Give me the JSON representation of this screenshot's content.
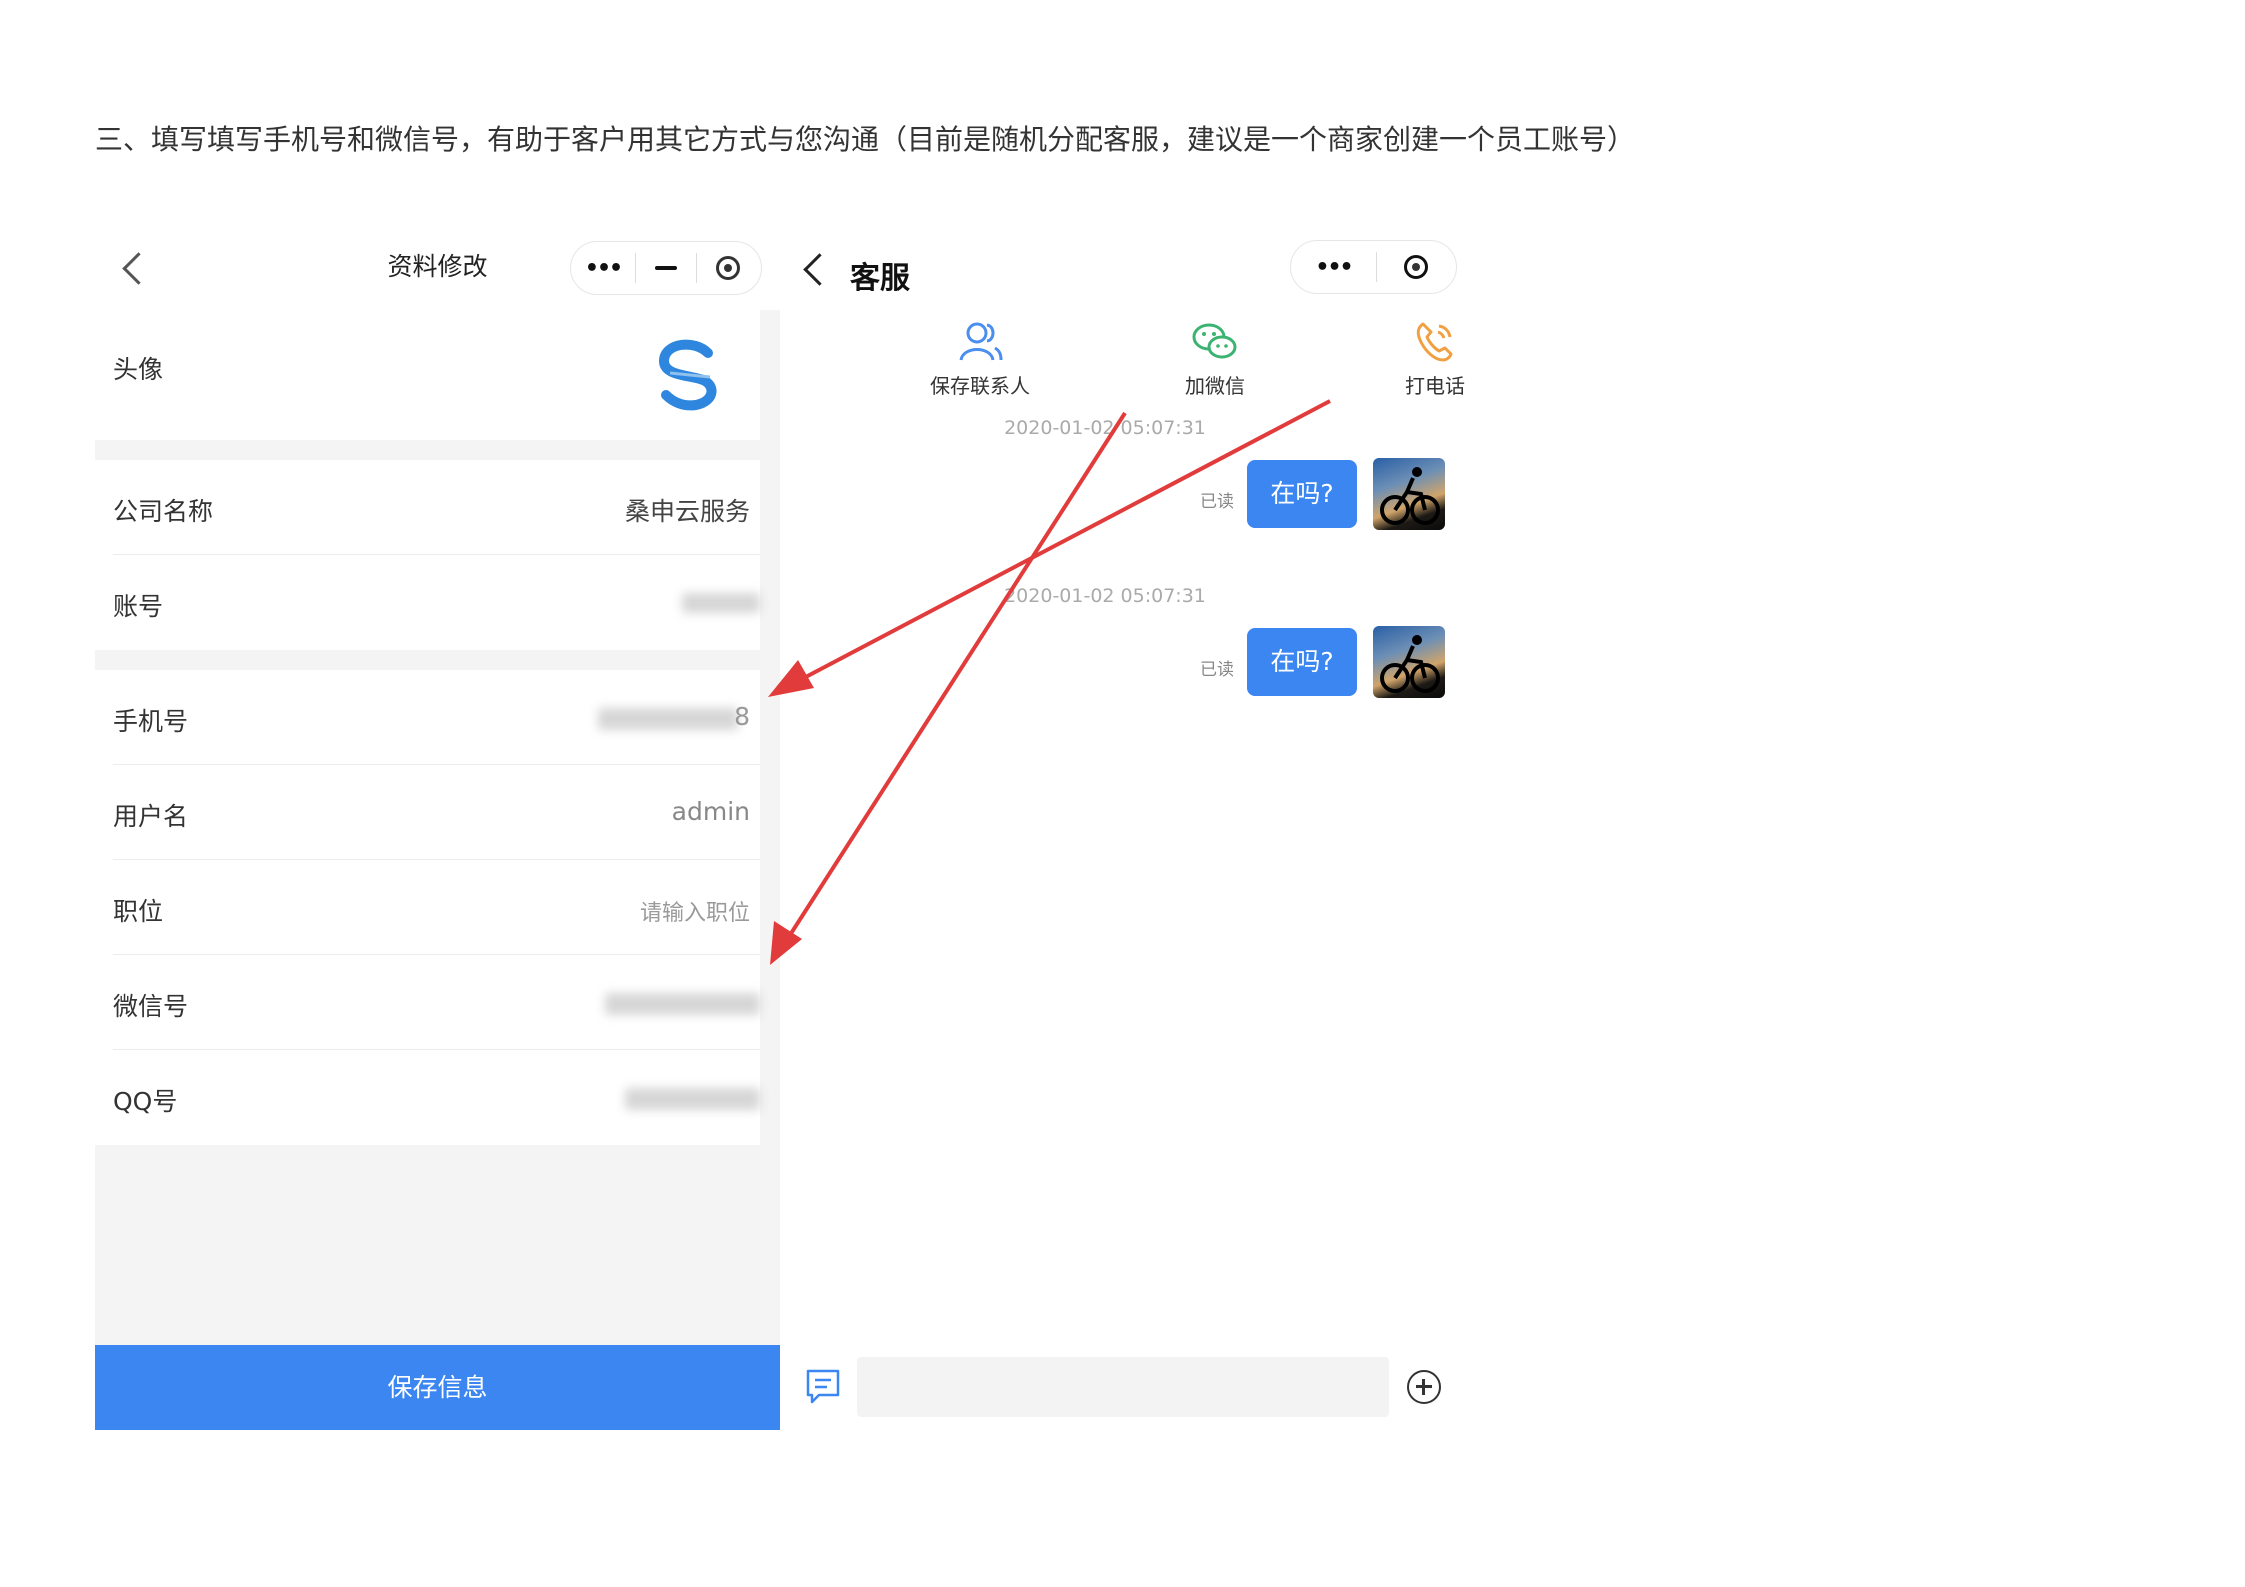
{
  "instruction": "三、填写填写手机号和微信号，有助于客户用其它方式与您沟通（目前是随机分配客服，建议是一个商家创建一个员工账号）",
  "profile_page": {
    "title": "资料修改",
    "capsule": {
      "menu": "•••"
    },
    "avatar_label": "头像",
    "company_label": "公司名称",
    "company_value": "桑申云服务",
    "account_label": "账号",
    "phone_label": "手机号",
    "phone_tail": "8",
    "username_label": "用户名",
    "username_value": "admin",
    "position_label": "职位",
    "position_placeholder": "请输入职位",
    "wechat_label": "微信号",
    "qq_label": "QQ号",
    "save_button": "保存信息"
  },
  "service_page": {
    "title": "客服",
    "capsule": {
      "menu": "•••"
    },
    "actions": [
      {
        "label": "保存联系人",
        "icon": "contacts-icon",
        "color": "#4a8ef0"
      },
      {
        "label": "加微信",
        "icon": "wechat-icon",
        "color": "#3cb371"
      },
      {
        "label": "打电话",
        "icon": "phone-icon",
        "color": "#f0a040"
      }
    ],
    "messages": [
      {
        "time": "2020-01-02 05:07:31",
        "status": "已读",
        "text": "在吗?"
      },
      {
        "time": "2020-01-02 05:07:31",
        "status": "已读",
        "text": "在吗?"
      }
    ]
  },
  "colors": {
    "accent": "#3b86f0",
    "arrow": "#e23b3b"
  }
}
